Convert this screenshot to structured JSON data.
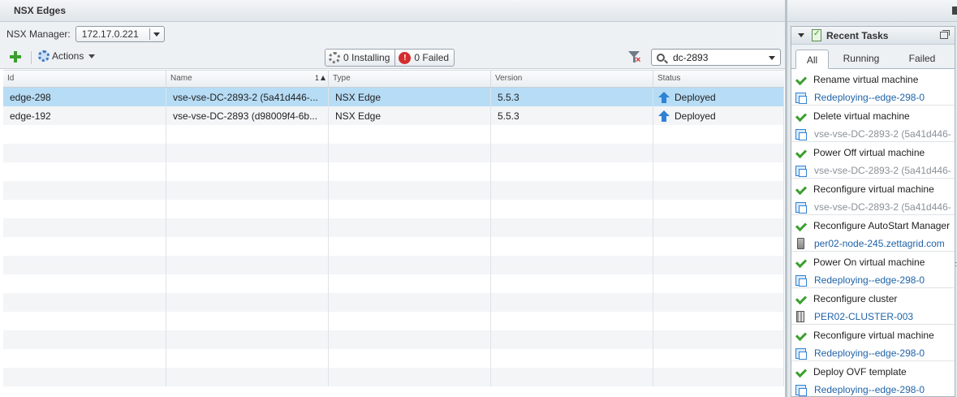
{
  "left_panel": {
    "title": "NSX Edges",
    "manager_label": "NSX Manager:",
    "manager_value": "172.17.0.221",
    "toolbar": {
      "actions_label": "Actions",
      "installing_label": "0 Installing",
      "failed_label": "0 Failed",
      "failed_glyph": "!",
      "search_value": "dc-2893"
    },
    "grid": {
      "columns": [
        "Id",
        "Name",
        "Type",
        "Version",
        "Status"
      ],
      "sort_indicator": "1",
      "rows": [
        {
          "id": "edge-298",
          "name": "vse-vse-DC-2893-2 (5a41d446-...",
          "type": "NSX Edge",
          "version": "5.5.3",
          "status": "Deployed",
          "selected": true
        },
        {
          "id": "edge-192",
          "name": "vse-vse-DC-2893 (d98009f4-6b...",
          "type": "NSX Edge",
          "version": "5.5.3",
          "status": "Deployed",
          "selected": false
        }
      ],
      "empty_rows": 14
    }
  },
  "right_panel": {
    "title": "Recent Tasks",
    "tabs": [
      "All",
      "Running",
      "Failed"
    ],
    "active_tab": "All",
    "tasks": [
      {
        "name": "Rename virtual machine",
        "target": "Redeploying--edge-298-0",
        "target_icon": "vm-icon",
        "target_style": "link"
      },
      {
        "name": "Delete virtual machine",
        "target": "vse-vse-DC-2893-2 (5a41d446-",
        "target_icon": "vm-icon",
        "target_style": "muted"
      },
      {
        "name": "Power Off virtual machine",
        "target": "vse-vse-DC-2893-2 (5a41d446-",
        "target_icon": "vm-icon",
        "target_style": "muted"
      },
      {
        "name": "Reconfigure virtual machine",
        "target": "vse-vse-DC-2893-2 (5a41d446-",
        "target_icon": "vm-icon",
        "target_style": "muted"
      },
      {
        "name": "Reconfigure AutoStart Manager",
        "target": "per02-node-245.zettagrid.com",
        "target_icon": "host-icon",
        "target_style": "link"
      },
      {
        "name": "Power On virtual machine",
        "target": "Redeploying--edge-298-0",
        "target_icon": "vm-icon",
        "target_style": "link"
      },
      {
        "name": "Reconfigure cluster",
        "target": "PER02-CLUSTER-003",
        "target_icon": "cluster-icon",
        "target_style": "link"
      },
      {
        "name": "Reconfigure virtual machine",
        "target": "Redeploying--edge-298-0",
        "target_icon": "vm-icon",
        "target_style": "link"
      },
      {
        "name": "Deploy OVF template",
        "target": "Redeploying--edge-298-0",
        "target_icon": "vm-icon",
        "target_style": "link"
      }
    ]
  },
  "colors": {
    "selected_row": "#b7dcf5",
    "success": "#3aa02d",
    "error": "#d42d2d",
    "link": "#1f63a8"
  }
}
